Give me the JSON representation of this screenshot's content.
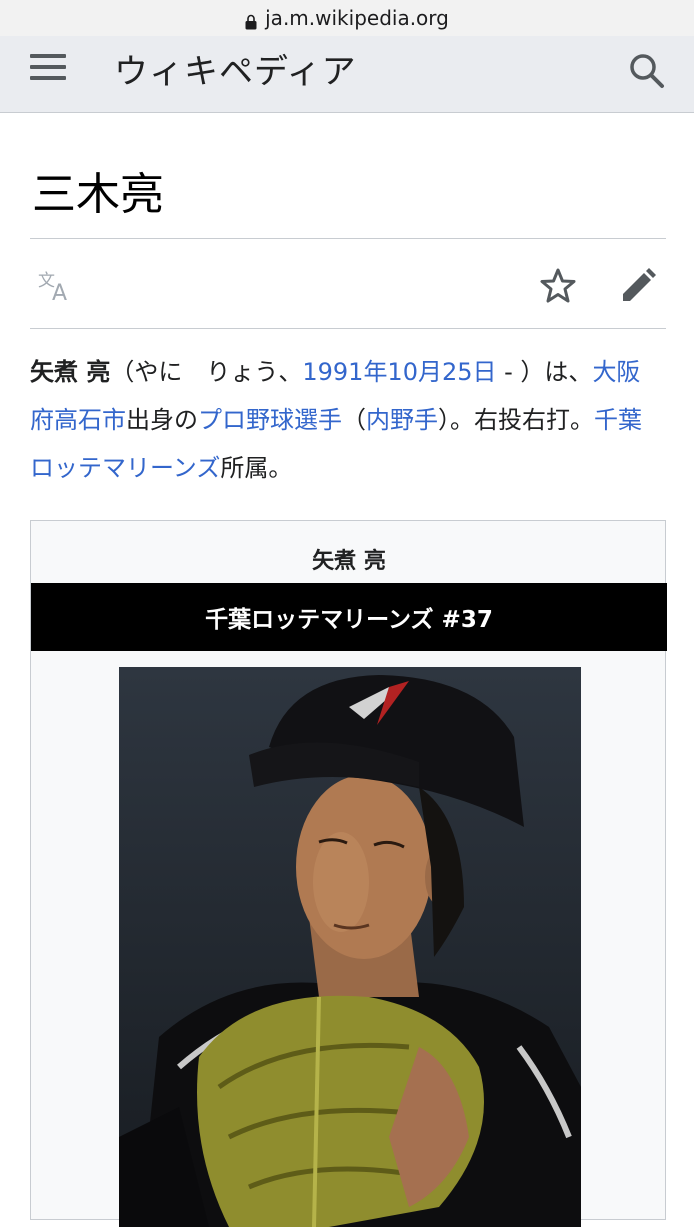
{
  "browser": {
    "url": "ja.m.wikipedia.org"
  },
  "header": {
    "brand": "ウィキペディア"
  },
  "article": {
    "title": "三木亮",
    "lead": {
      "name_bold": "矢煮 亮",
      "reading": "（やに　りょう、",
      "birthdate_link": "1991年10月25日",
      "after_birthdate": " - ）は、",
      "birthplace_link": "大阪府高石市",
      "after_birthplace": "出身の",
      "occupation_link": "プロ野球選手",
      "paren_open": "（",
      "position_link": "内野手",
      "after_position": "）。右投右打。",
      "team_link": "千葉ロッテマリーンズ",
      "after_team": "所属。"
    }
  },
  "infobox": {
    "name": "矢煮 亮",
    "team": "千葉ロッテマリーンズ #37"
  },
  "colors": {
    "link": "#3366cc",
    "header_bg": "#eaecf0",
    "team_bar": "#000000"
  }
}
